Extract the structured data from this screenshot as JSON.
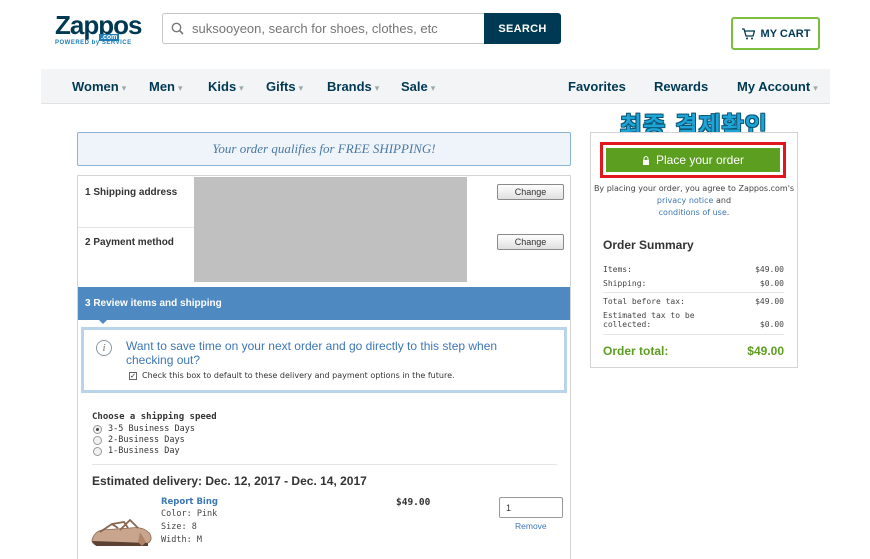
{
  "header": {
    "logo_text": "Zappos",
    "logo_com": ".com",
    "logo_tagline": "POWERED by SERVICE",
    "search_placeholder": "suksooyeon, search for shoes, clothes, etc",
    "search_button": "SEARCH",
    "cart_label": "MY CART"
  },
  "nav": {
    "left": [
      "Women",
      "Men",
      "Kids",
      "Gifts",
      "Brands",
      "Sale"
    ],
    "right": [
      "Favorites",
      "Rewards",
      "My Account"
    ]
  },
  "overlay_label": "최종 결제확인",
  "free_shipping_banner": "Your order qualifies for FREE SHIPPING!",
  "steps": {
    "shipping": {
      "label": "1  Shipping address",
      "change": "Change"
    },
    "payment": {
      "label": "2  Payment method",
      "change": "Change"
    },
    "review": {
      "label": "3  Review items and shipping"
    }
  },
  "info_box": {
    "text": "Want to save time on your next order and go directly to this step when checking out?",
    "checkbox_label": "Check this box to default to these delivery and payment options in the future.",
    "checked": true
  },
  "shipping_speed": {
    "title": "Choose a shipping speed",
    "options": [
      "3-5 Business Days",
      "2-Business Days",
      "1-Business Day"
    ],
    "selected": "3-5 Business Days"
  },
  "estimated_delivery": "Estimated delivery: Dec. 12, 2017 - Dec. 14, 2017",
  "item": {
    "name": "Report Bing",
    "color": "Color: Pink",
    "size": "Size: 8",
    "width": "Width: M",
    "price": "$49.00",
    "quantity": "1",
    "remove": "Remove"
  },
  "summary": {
    "place_order": "Place your order",
    "agree_prefix": "By placing your order, you agree to Zappos.com's",
    "privacy": "privacy notice",
    "and": "and",
    "conditions": "conditions of use",
    "period": ".",
    "title": "Order Summary",
    "items_label": "Items:",
    "items_value": "$49.00",
    "shipping_label": "Shipping:",
    "shipping_value": "$0.00",
    "before_tax_label": "Total before tax:",
    "before_tax_value": "$49.00",
    "tax_label": "Estimated tax to be collected:",
    "tax_value": "$0.00",
    "total_label": "Order total:",
    "total_value": "$49.00"
  },
  "colors": {
    "brand_navy": "#003953",
    "link_blue": "#3d77b4",
    "order_green": "#5c9e1f",
    "highlight_red": "#e0171d",
    "step_blue": "#4e89c2"
  }
}
